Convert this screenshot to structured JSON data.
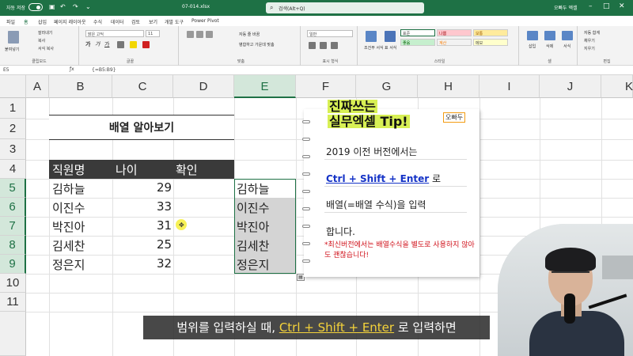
{
  "titlebar": {
    "autosave": "자동 저장",
    "filename": "07-014.xlsx",
    "search_placeholder": "검색(Alt+Q)",
    "user": "오빠두 엑셀",
    "colors": {
      "bar": "#1e7145"
    }
  },
  "tabs": [
    "파일",
    "홈",
    "삽입",
    "페이지 레이아웃",
    "수식",
    "데이터",
    "검토",
    "보기",
    "개발 도구",
    "Power Pivot"
  ],
  "ribbon": {
    "clipboard": {
      "paste": "붙여넣기",
      "cut": "잘라내기",
      "copy": "복사",
      "format_painter": "서식 복사",
      "label": "클립보드"
    },
    "font": {
      "name": "맑은 고딕",
      "size": "11",
      "label": "글꼴"
    },
    "alignment": {
      "wrap": "자동 줄 바꿈",
      "merge": "병합하고 가운데 맞춤",
      "label": "맞춤"
    },
    "number": {
      "format": "일반",
      "label": "표시 형식"
    },
    "styles": {
      "conditional": "조건부 서식",
      "table": "표 서식",
      "normal": "표준",
      "bad": "나쁨",
      "good": "좋음",
      "neutral": "보통",
      "calc": "계산",
      "check": "메모",
      "label": "스타일"
    },
    "cells": {
      "insert": "삽입",
      "delete": "삭제",
      "format": "서식",
      "label": "셀"
    },
    "editing": {
      "autosum": "자동 합계",
      "fill": "채우기",
      "clear": "지우기",
      "label": "편집"
    }
  },
  "formula_bar": {
    "name_box": "E5",
    "formula": "{=B5:B9}"
  },
  "grid": {
    "columns": [
      "A",
      "B",
      "C",
      "D",
      "E",
      "F",
      "G",
      "H",
      "I",
      "J",
      "K"
    ],
    "rows": [
      "1",
      "2",
      "3",
      "4",
      "5",
      "6",
      "7",
      "8",
      "9",
      "10",
      "11"
    ],
    "selected_column": "E",
    "title": "배열 알아보기",
    "headers": {
      "name": "직원명",
      "age": "나이",
      "check": "확인"
    },
    "data": [
      {
        "name": "김하늘",
        "age": "29",
        "result": "김하늘"
      },
      {
        "name": "이진수",
        "age": "33",
        "result": "이진수"
      },
      {
        "name": "박진아",
        "age": "31",
        "result": "박진아"
      },
      {
        "name": "김세찬",
        "age": "25",
        "result": "김세찬"
      },
      {
        "name": "정은지",
        "age": "32",
        "result": "정은지"
      }
    ]
  },
  "tip": {
    "title_line1": "진짜쓰는",
    "title_line2": "실무엑셀 Tip!",
    "brand": "오빠두",
    "line1": "2019 이전 버전에서는",
    "line2_key": "Ctrl + Shift + Enter",
    "line2_suffix": " 로",
    "line3": "배열(=배열 수식)을 입력",
    "line4": "합니다.",
    "note": "*최신버전에서는 배열수식을 별도로 사용하지 않아도 괜찮습니다!"
  },
  "subtitle": {
    "prefix": "범위를 입력하실 때, ",
    "highlight": "Ctrl + Shift + Enter",
    "suffix": " 로 입력하면"
  }
}
